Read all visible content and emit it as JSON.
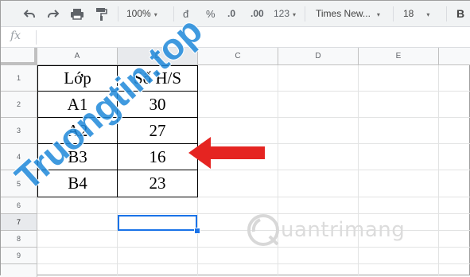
{
  "toolbar": {
    "zoom": "100%",
    "currency": "đ",
    "percent": "%",
    "dec_decrease": ".0",
    "dec_increase": ".00",
    "format_more": "123",
    "font": "Times New...",
    "font_size": "18",
    "bold": "B"
  },
  "formula_bar": {
    "fx": "fx",
    "value": ""
  },
  "columns": [
    "A",
    "B",
    "C",
    "D",
    "E"
  ],
  "rows": [
    "1",
    "2",
    "3",
    "4",
    "5",
    "6",
    "7",
    "8",
    "9"
  ],
  "table": {
    "header": [
      "Lớp",
      "Số H/S"
    ],
    "rows": [
      [
        "A1",
        "30"
      ],
      [
        "A2",
        "27"
      ],
      [
        "B3",
        "16"
      ],
      [
        "B4",
        "23"
      ]
    ]
  },
  "selected_cell": "B7",
  "colors": {
    "accent": "#1a73e8",
    "arrow": "#e52421",
    "watermark_blue": "#1e88d9",
    "watermark_orange": "#f39c33"
  },
  "watermarks": {
    "top": "Truongtin.top",
    "bottom": "uantrimang"
  }
}
